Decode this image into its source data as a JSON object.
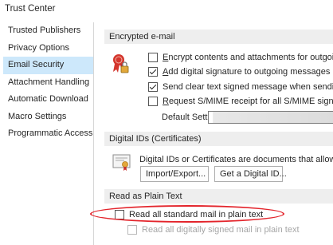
{
  "window": {
    "title": "Trust Center"
  },
  "sidebar": {
    "items": [
      {
        "label": "Trusted Publishers",
        "selected": false
      },
      {
        "label": "Privacy Options",
        "selected": false
      },
      {
        "label": "Email Security",
        "selected": true
      },
      {
        "label": "Attachment Handling",
        "selected": false
      },
      {
        "label": "Automatic Download",
        "selected": false
      },
      {
        "label": "Macro Settings",
        "selected": false
      },
      {
        "label": "Programmatic Access",
        "selected": false
      }
    ]
  },
  "encrypted": {
    "header": "Encrypted e-mail",
    "icon": "certificate-ribbon-lock-icon",
    "options": [
      {
        "label": "Encrypt contents and attachments for outgoing me",
        "checked": false,
        "underline": "E",
        "rest": "ncrypt contents and attachments for outgoing me"
      },
      {
        "label": "Add digital signature to outgoing messages",
        "checked": true,
        "underline": "A",
        "rest": "dd digital signature to outgoing messages"
      },
      {
        "label": "Send clear text signed message when sending signe",
        "checked": true,
        "underline": "",
        "rest": "Send clear text signed message when sending signe"
      },
      {
        "label": "Request S/MIME receipt for all S/MIME signed mes",
        "checked": false,
        "underline": "R",
        "rest": "equest S/MIME receipt for all S/MIME signed mes"
      }
    ],
    "default_setting_label": "Default Setting:",
    "default_setting_value": ""
  },
  "digital_ids": {
    "header": "Digital IDs (Certificates)",
    "icon": "certificate-document-icon",
    "description": "Digital IDs or Certificates are documents that allow you to",
    "import_export_button": "Import/Export...",
    "get_id_button": "Get a Digital ID..."
  },
  "plain_text": {
    "header": "Read as Plain Text",
    "read_all_standard": {
      "label": "Read all standard mail in plain text",
      "checked": false
    },
    "read_all_signed": {
      "label": "Read all digitally signed mail in plain text",
      "checked": false,
      "disabled": true
    }
  },
  "colors": {
    "selected_bg": "#cde8fb",
    "header_bg": "#eeeeee",
    "highlight_ellipse": "#e3242b"
  }
}
